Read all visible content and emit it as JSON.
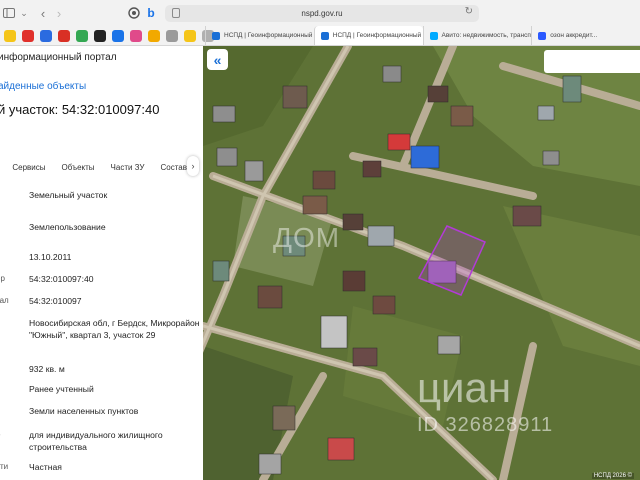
{
  "browser": {
    "address": "nspd.gov.ru",
    "tabs": [
      {
        "title": "НСПД | Геоинформационный по...",
        "active": false,
        "color": "#1a6fd6"
      },
      {
        "title": "НСПД | Геоинформационный по...",
        "active": true,
        "color": "#1a6fd6"
      },
      {
        "title": "Авито: недвижимость, транспо...",
        "active": false,
        "color": "#00aaff"
      },
      {
        "title": "озон аккредит...",
        "active": false,
        "color": "#2b59ff"
      }
    ],
    "favorites": [
      {
        "icon": "yellow-bookmark-icon",
        "color": "#f5c518"
      },
      {
        "icon": "red-bookmark-icon",
        "color": "#e0302b"
      },
      {
        "icon": "blue-diamond-icon",
        "color": "#2b6be0"
      },
      {
        "icon": "red-mail-icon",
        "color": "#d93025"
      },
      {
        "icon": "green-g-icon",
        "color": "#34a853"
      },
      {
        "icon": "black-t-icon",
        "color": "#222222"
      },
      {
        "icon": "blue-star-icon",
        "color": "#1a73e8"
      },
      {
        "icon": "pink-bookmark-icon",
        "color": "#e04a8a"
      },
      {
        "icon": "yellow-chart-icon",
        "color": "#f2a900"
      },
      {
        "icon": "grey-cube-icon",
        "color": "#9a9a9a"
      },
      {
        "icon": "yellow-circle-icon",
        "color": "#f5c518"
      },
      {
        "icon": "grey-list-icon",
        "color": "#b0b0b0"
      }
    ]
  },
  "panel": {
    "portal_title": "информационный портал",
    "back_link": "айденные объекты",
    "parcel_title": "й участок: 54:32:010097:40",
    "tabs": [
      "Сервисы",
      "Объекты",
      "Части ЗУ",
      "Состав"
    ],
    "rows": [
      {
        "label": "",
        "value": "Земельный участок"
      },
      {
        "label": "",
        "value": "Землепользование"
      },
      {
        "label": "",
        "value": "13.10.2011"
      },
      {
        "label": "ер",
        "value": "54:32:010097:40"
      },
      {
        "label": "тал",
        "value": "54:32:010097"
      },
      {
        "label": "",
        "value": "Новосибирская обл, г Бердск, Микрорайон \"Южный\", квартал 3, участок 29"
      },
      {
        "label": "",
        "value": "932 кв. м"
      },
      {
        "label": "",
        "value": "Ранее учтенный"
      },
      {
        "label": "",
        "value": "Земли населенных пунктов"
      },
      {
        "label": "о",
        "value": "для индивидуального жилищного строительства"
      },
      {
        "label": "сти",
        "value": "Частная"
      }
    ]
  },
  "map": {
    "collapse_symbol": "«",
    "copyright": "НСПД 2026 ©",
    "watermark_top": "ДОМ",
    "watermark_brand": "циан",
    "watermark_id": "ID 326828911"
  },
  "colors": {
    "accent": "#1a6fd6",
    "parcel_outline": "#b23bd6"
  }
}
